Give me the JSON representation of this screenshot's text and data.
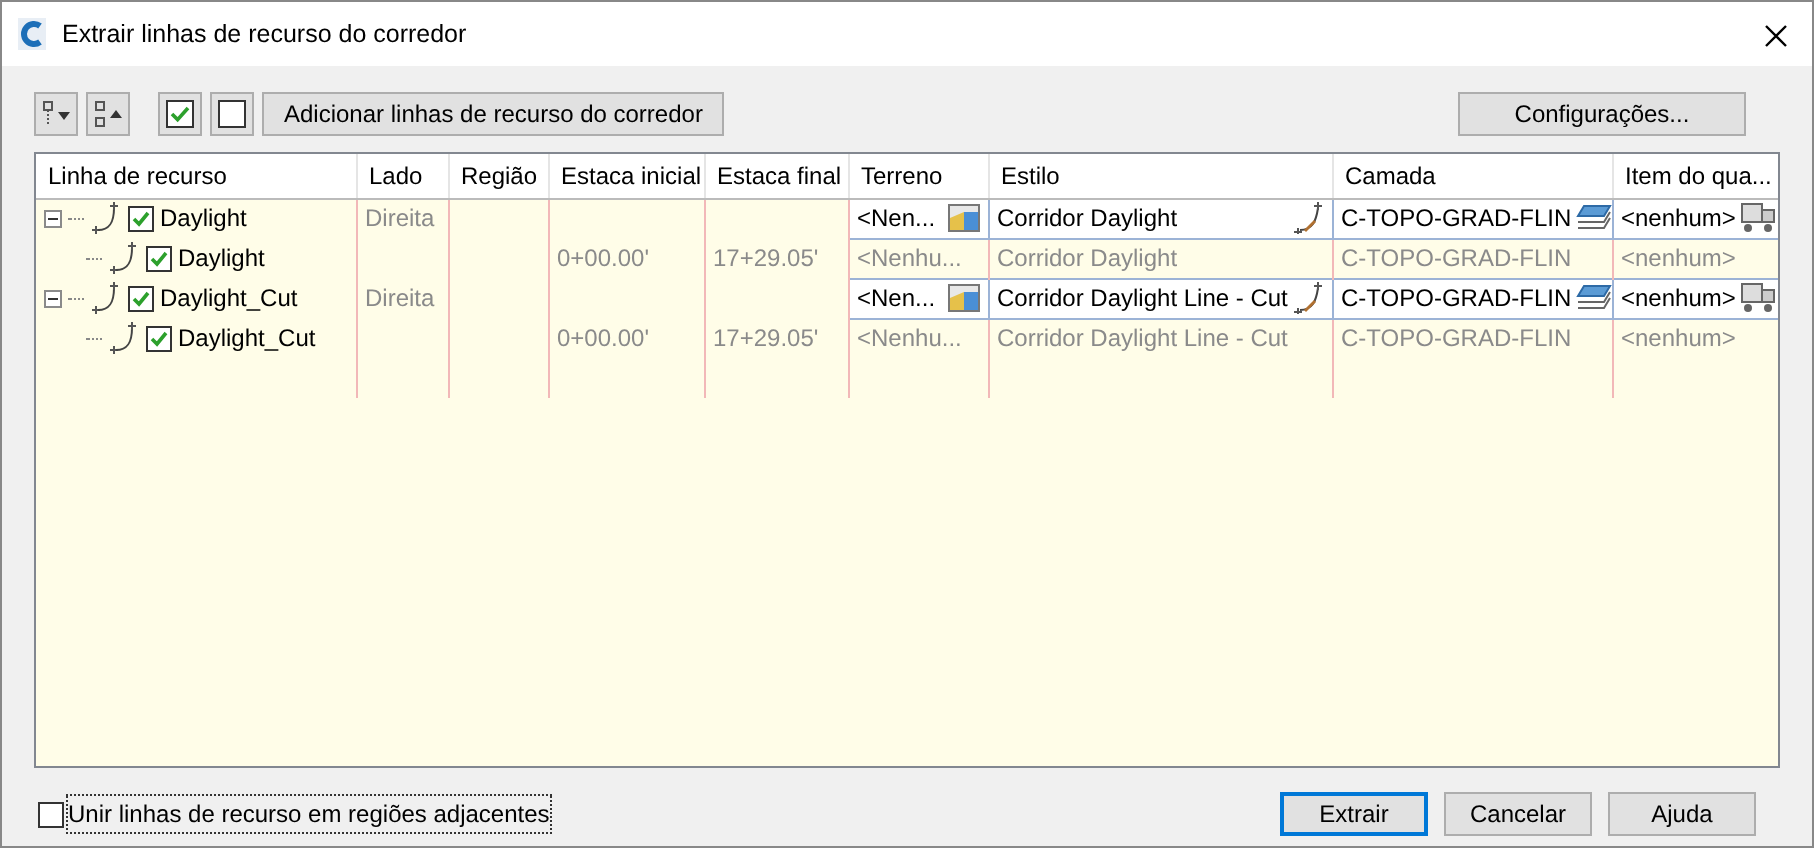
{
  "window": {
    "title": "Extrair linhas de recurso do corredor"
  },
  "toolbar": {
    "add_button": "Adicionar linhas de recurso do corredor",
    "settings_button": "Configurações..."
  },
  "table": {
    "columns": [
      "Linha de recurso",
      "Lado",
      "Região",
      "Estaca inicial",
      "Estaca final",
      "Terreno",
      "Estilo",
      "Camada",
      "Item do qua..."
    ],
    "rows": [
      {
        "name": "Daylight",
        "checked": true,
        "expanded": true,
        "side": "Direita",
        "terrain": "<Nen...",
        "style": "Corridor Daylight",
        "layer": "C-TOPO-GRAD-FLIN",
        "item": "<nenhum>",
        "children": [
          {
            "name": "Daylight",
            "checked": true,
            "start": "0+00.00'",
            "end": "17+29.05'",
            "terrain": "<Nenhu...",
            "style": "Corridor Daylight",
            "layer": "C-TOPO-GRAD-FLIN",
            "item": "<nenhum>"
          }
        ]
      },
      {
        "name": "Daylight_Cut",
        "checked": true,
        "expanded": true,
        "side": "Direita",
        "terrain": "<Nen...",
        "style": "Corridor Daylight Line - Cut",
        "layer": "C-TOPO-GRAD-FLIN",
        "item": "<nenhum>",
        "children": [
          {
            "name": "Daylight_Cut",
            "checked": true,
            "start": "0+00.00'",
            "end": "17+29.05'",
            "terrain": "<Nenhu...",
            "style": "Corridor Daylight Line - Cut",
            "layer": "C-TOPO-GRAD-FLIN",
            "item": "<nenhum>"
          }
        ]
      }
    ]
  },
  "join_option": {
    "label": "Unir linhas de recurso em regiões adjacentes",
    "checked": false
  },
  "buttons": [
    {
      "label": "Extrair",
      "default": true
    },
    {
      "label": "Cancelar",
      "default": false
    },
    {
      "label": "Ajuda",
      "default": false
    }
  ]
}
